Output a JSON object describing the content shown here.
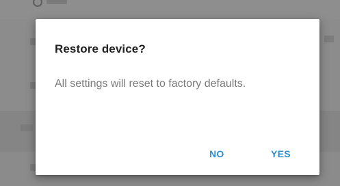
{
  "dialog": {
    "title": "Restore device?",
    "message": "All settings will reset to factory defaults.",
    "negative_button_label": "NO",
    "positive_button_label": "YES"
  },
  "colors": {
    "scrim": "#8a8a8a",
    "dialog_background": "#ffffff",
    "title_text": "#222222",
    "message_text": "#7a7a7a",
    "accent_button": "#2f8fcf"
  },
  "background_icons": [
    "radio-button-icon"
  ]
}
